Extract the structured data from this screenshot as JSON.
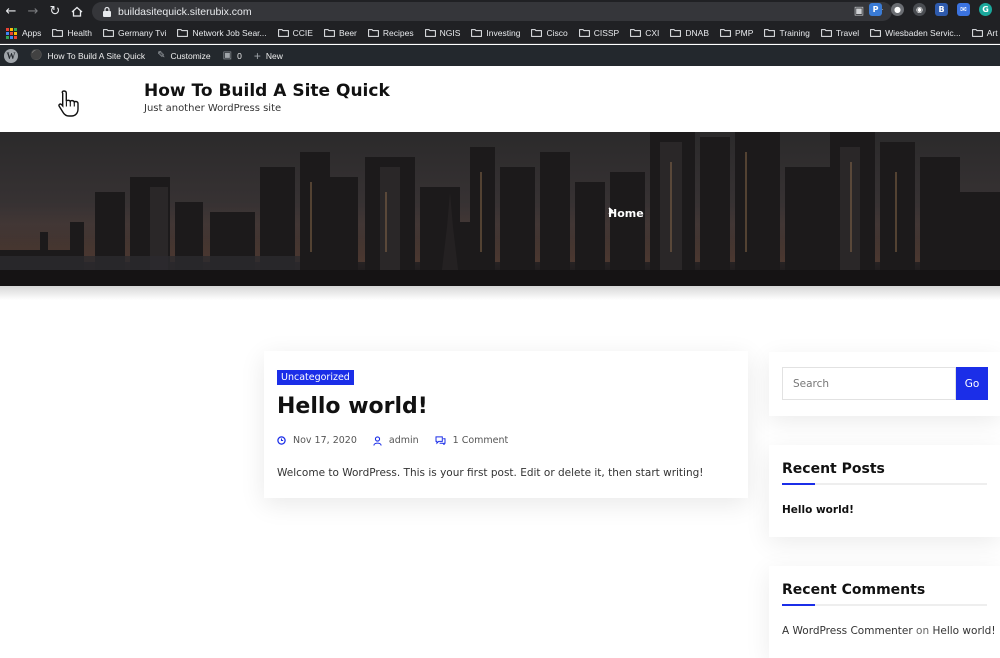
{
  "browser": {
    "url": "buildasitequick.siterubix.com",
    "bookmarks": [
      "Apps",
      "Health",
      "Germany Tvi",
      "Network Job Sear...",
      "CCIE",
      "Beer",
      "Recipes",
      "NGIS",
      "Investing",
      "Cisco",
      "CISSP",
      "CXI",
      "DNAB",
      "PMP",
      "Training",
      "Travel",
      "Wiesbaden Servic...",
      "Art"
    ]
  },
  "adminbar": {
    "site_name": "How To Build A Site Quick",
    "customize": "Customize",
    "comments_count": "0",
    "new": "New"
  },
  "site": {
    "title": "How To Build A Site Quick",
    "tagline": "Just another WordPress site"
  },
  "hero": {
    "breadcrumb": "Home"
  },
  "post": {
    "category": "Uncategorized",
    "title": "Hello world!",
    "date": "Nov 17, 2020",
    "author": "admin",
    "comments": "1 Comment",
    "excerpt": "Welcome to WordPress. This is your first post. Edit or delete it, then start writing!"
  },
  "sidebar": {
    "search_placeholder": "Search",
    "search_button": "Go",
    "recent_posts_title": "Recent Posts",
    "recent_posts": [
      "Hello world!"
    ],
    "recent_comments_title": "Recent Comments",
    "comment_author": "A WordPress Commenter",
    "comment_on": "on",
    "comment_post": "Hello world!"
  },
  "colors": {
    "accent": "#1b2ee8",
    "admin_bar": "#23282d",
    "chrome": "#202124"
  }
}
